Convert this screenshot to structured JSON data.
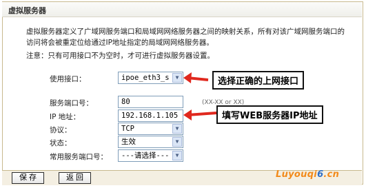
{
  "title": "虚拟服务器",
  "description": "虚拟服务器定义了广域网服务端口和局域网网络服务器之间的映射关系，所有对该广域网服务端口的访问将会被重定位给通过IP地址指定的局域网网络服务器。",
  "note": "注意：只有可用接口不为空时，才可进行虚拟服务器设置。",
  "form": {
    "interface_label": "使用接口：",
    "interface_value": "ipoe_eth3_s",
    "service_port_label": "服务端口号：",
    "service_port_value": "80",
    "service_port_hint": "(XX-XX or XX)",
    "ip_label": "IP 地址：",
    "ip_value": "192.168.1.105",
    "protocol_label": "协议：",
    "protocol_value": "TCP",
    "status_label": "状态：",
    "status_value": "生效",
    "common_port_label": "常用服务端口号：",
    "common_port_value": "---请选择---"
  },
  "callouts": {
    "interface": "选择正确的上网接口",
    "ip": "填写WEB服务器IP地址"
  },
  "buttons": {
    "save": "保 存",
    "back": "返 回"
  },
  "watermark": {
    "part1": "Luyouqi",
    "part2": "6",
    "part3": ".cn"
  },
  "colors": {
    "arrow": "#e0281e",
    "frame": "#c8b98e"
  }
}
